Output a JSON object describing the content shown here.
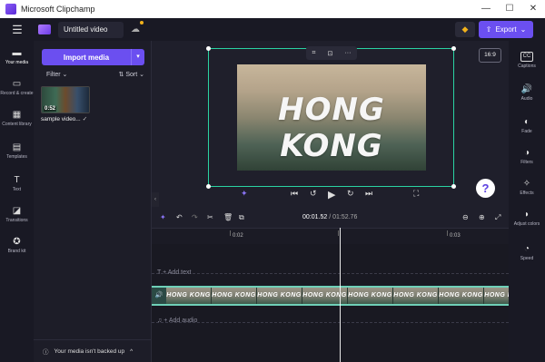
{
  "window": {
    "app_title": "Microsoft Clipchamp",
    "min": "—",
    "max": "☐",
    "close": "✕"
  },
  "topbar": {
    "menu_glyph": "☰",
    "project_title": "Untitled video",
    "export_label": "Export",
    "export_glyph": "⇧",
    "gem_glyph": "◆",
    "cloud_glyph": "☁"
  },
  "left_nav": [
    {
      "label": "Your media",
      "glyph": "▬"
    },
    {
      "label": "Record & create",
      "glyph": "▭"
    },
    {
      "label": "Content library",
      "glyph": "▦"
    },
    {
      "label": "Templates",
      "glyph": "▤"
    },
    {
      "label": "Text",
      "glyph": "T"
    },
    {
      "label": "Transitions",
      "glyph": "◪"
    },
    {
      "label": "Brand kit",
      "glyph": "✪"
    }
  ],
  "media": {
    "import_label": "Import media",
    "import_drop": "▾",
    "filter_label": "Filter ⌄",
    "sort_label": "⇅ Sort ⌄",
    "thumb_duration": "0:52",
    "thumb_name": "sample video...",
    "thumb_check": "✓",
    "backup_text": "Your media isn't backed up",
    "backup_icon": "ⓘ",
    "backup_caret": "^"
  },
  "preview": {
    "video_title": "HONG KONG",
    "aspect_ratio": "16:9",
    "help_glyph": "?",
    "mini_tools": [
      "⌗",
      "⊡",
      "···"
    ],
    "controls": [
      "⏮",
      "↺",
      "▶",
      "↻",
      "⏭"
    ],
    "left_ctrl": "✦",
    "right_ctrl": "⛶"
  },
  "right_nav": [
    {
      "label": "Captions",
      "glyph": "CC"
    },
    {
      "label": "Audio",
      "glyph": "🔊"
    },
    {
      "label": "Fade",
      "glyph": "◐"
    },
    {
      "label": "Filters",
      "glyph": "◑"
    },
    {
      "label": "Effects",
      "glyph": "✧"
    },
    {
      "label": "Adjust colors",
      "glyph": "◗"
    },
    {
      "label": "Speed",
      "glyph": "◔"
    }
  ],
  "timeline": {
    "current_time": "00:01.52",
    "total_time": "/ 01:52.76",
    "ruler_marks": [
      "0:02",
      "0:03"
    ],
    "add_text": "+ Add text",
    "add_audio": "+ Add audio",
    "clip_label": "HONG KONG",
    "tools": [
      "✦",
      "↶",
      "↷",
      "✂",
      "🗑",
      "⧉"
    ],
    "zoom_tools": [
      "⊖",
      "⊕",
      "⤢"
    ],
    "text_track_icon": "T",
    "audio_track_icon": "♫",
    "audio_clip_icon": "🔊"
  }
}
